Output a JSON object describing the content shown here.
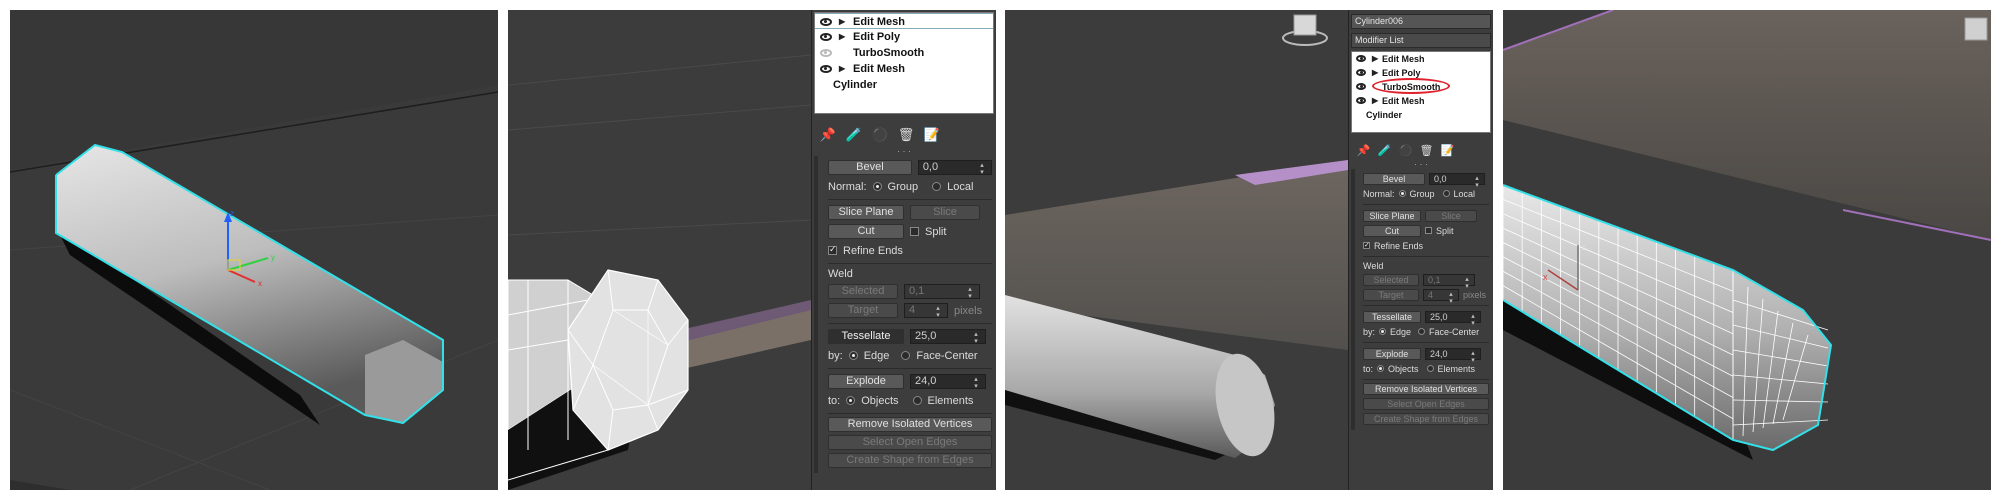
{
  "panel2": {
    "stack": [
      {
        "label": "Edit Mesh",
        "eye": true,
        "arrow": true
      },
      {
        "label": "Edit Poly",
        "eye": true,
        "arrow": true
      },
      {
        "label": "TurboSmooth",
        "eye": false,
        "arrow": false
      },
      {
        "label": "Edit Mesh",
        "eye": true,
        "arrow": true
      },
      {
        "label": "Cylinder",
        "base": true
      }
    ]
  },
  "panel3": {
    "object_name": "Cylinder006",
    "modifier_list": "Modifier List",
    "stack": [
      {
        "label": "Edit Mesh",
        "eye": true,
        "arrow": true
      },
      {
        "label": "Edit Poly",
        "eye": true,
        "arrow": true
      },
      {
        "label": "TurboSmooth",
        "eye": true,
        "arrow": false,
        "highlighted": true
      },
      {
        "label": "Edit Mesh",
        "eye": true,
        "arrow": true
      },
      {
        "label": "Cylinder",
        "base": true
      }
    ]
  },
  "rollout": {
    "bevel_label": "Bevel",
    "bevel_value": "0,0",
    "normal_label": "Normal:",
    "normal_group": "Group",
    "normal_local": "Local",
    "slice_plane": "Slice Plane",
    "slice": "Slice",
    "cut": "Cut",
    "split": "Split",
    "refine_ends": "Refine Ends",
    "weld_label": "Weld",
    "selected": "Selected",
    "selected_value": "0,1",
    "target": "Target",
    "target_value": "4",
    "pixels": "pixels",
    "tessellate": "Tessellate",
    "tessellate_value": "25,0",
    "by_label": "by:",
    "by_edge": "Edge",
    "by_face_center": "Face-Center",
    "explode": "Explode",
    "explode_value": "24,0",
    "to_label": "to:",
    "to_objects": "Objects",
    "to_elements": "Elements",
    "remove_isolated": "Remove Isolated Vertices",
    "select_open_edges": "Select Open Edges",
    "create_shape": "Create Shape from Edges"
  },
  "icons": {
    "pin": "pin-icon",
    "tube": "modifier-icon",
    "unique": "make-unique-icon",
    "delete": "trash-icon",
    "configure": "configure-icon"
  },
  "colors": {
    "selection_outline": "#33e0e8",
    "highlight_circle": "#e0202c",
    "viewport_bg": "#3b3b3b"
  }
}
